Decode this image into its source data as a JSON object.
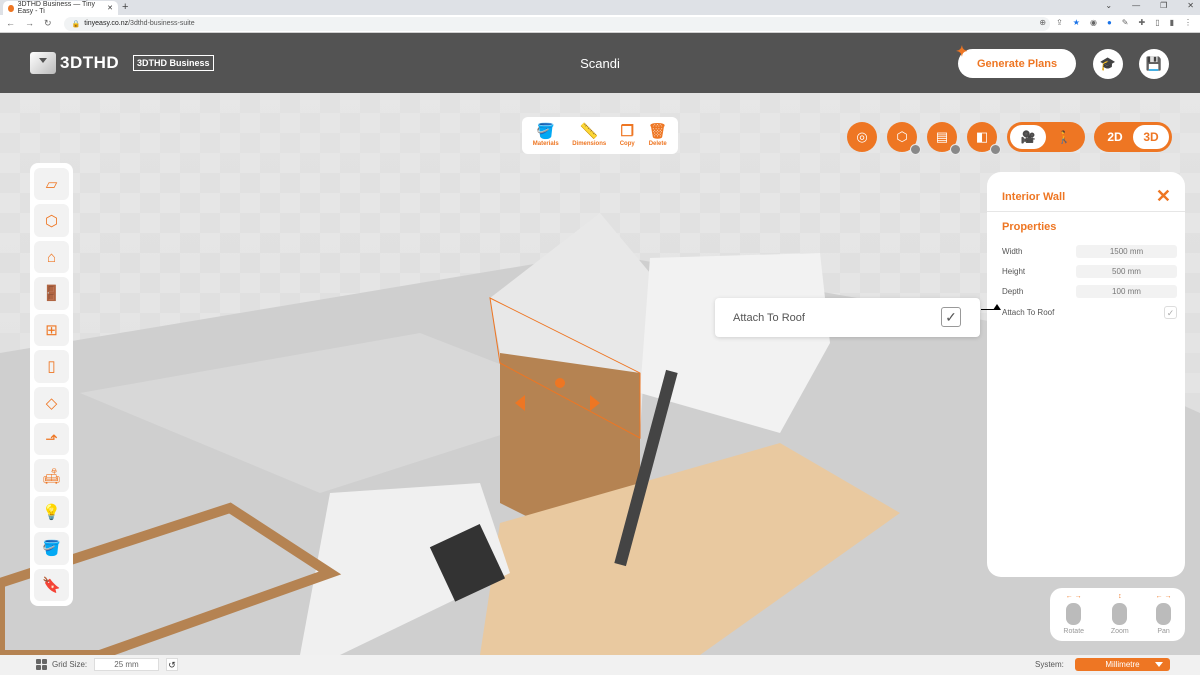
{
  "browser": {
    "tab_title": "3DTHD Business — Tiny Easy - Ti",
    "url_host": "tinyeasy.co.nz",
    "url_path": "/3dthd-business-suite"
  },
  "header": {
    "logo_text": "3DTHD",
    "badge": "3DTHD Business",
    "project_title": "Scandi",
    "generate_label": "Generate Plans",
    "icons": [
      "graduation-cap-icon",
      "save-icon"
    ]
  },
  "toolbar": {
    "items": [
      {
        "label": "Materials",
        "icon": "paint-bucket-icon"
      },
      {
        "label": "Dimensions",
        "icon": "ruler-icon"
      },
      {
        "label": "Copy",
        "icon": "copy-icon"
      },
      {
        "label": "Delete",
        "icon": "trash-icon"
      }
    ]
  },
  "view_controls": {
    "camera_label": "🎥",
    "walk_label": "🚶",
    "mode_2d": "2D",
    "mode_3d": "3D",
    "active_mode": "3D"
  },
  "sidebar": {
    "items": [
      "floor",
      "walls",
      "roof",
      "doors",
      "windows",
      "panels",
      "ceiling",
      "stairs",
      "furniture",
      "lighting",
      "materials",
      "bookmarks"
    ]
  },
  "panel": {
    "title": "Interior Wall",
    "section": "Properties",
    "props": [
      {
        "label": "Width",
        "value": "1500 mm"
      },
      {
        "label": "Height",
        "value": "500 mm"
      },
      {
        "label": "Depth",
        "value": "100 mm"
      }
    ],
    "attach_label": "Attach To Roof",
    "attach_checked": true
  },
  "tooltip": {
    "label": "Attach To Roof",
    "checked": true
  },
  "mouse_controls": [
    {
      "label": "Rotate"
    },
    {
      "label": "Zoom"
    },
    {
      "label": "Pan"
    }
  ],
  "status": {
    "grid_label": "Grid Size:",
    "grid_value": "25 mm",
    "system_label": "System:",
    "system_value": "Millimetre"
  },
  "colors": {
    "accent": "#ee7623",
    "appbar": "#535353"
  }
}
